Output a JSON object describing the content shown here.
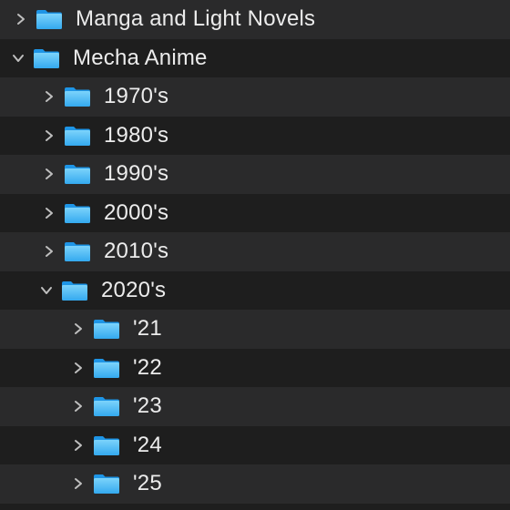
{
  "colors": {
    "row_alt": "#2a2a2b",
    "row_base": "#1e1e1e",
    "text": "#ececec",
    "chevron": "#bfbfbf",
    "folder_light": "#7cd3fb",
    "folder_dark": "#34a9ef",
    "folder_tab": "#1e95e6"
  },
  "tree": {
    "items": [
      {
        "label": "Manga and Light Novels",
        "expanded": false,
        "icon": "folder-icon"
      },
      {
        "label": "Mecha Anime",
        "expanded": true,
        "icon": "folder-icon"
      },
      {
        "label": "1970's",
        "expanded": false,
        "icon": "folder-icon"
      },
      {
        "label": "1980's",
        "expanded": false,
        "icon": "folder-icon"
      },
      {
        "label": "1990's",
        "expanded": false,
        "icon": "folder-icon"
      },
      {
        "label": "2000's",
        "expanded": false,
        "icon": "folder-icon"
      },
      {
        "label": "2010's",
        "expanded": false,
        "icon": "folder-icon"
      },
      {
        "label": "2020's",
        "expanded": true,
        "icon": "folder-icon"
      },
      {
        "label": "'21",
        "expanded": false,
        "icon": "folder-icon"
      },
      {
        "label": "'22",
        "expanded": false,
        "icon": "folder-icon"
      },
      {
        "label": "'23",
        "expanded": false,
        "icon": "folder-icon"
      },
      {
        "label": "'24",
        "expanded": false,
        "icon": "folder-icon"
      },
      {
        "label": "'25",
        "expanded": false,
        "icon": "folder-icon"
      }
    ]
  }
}
